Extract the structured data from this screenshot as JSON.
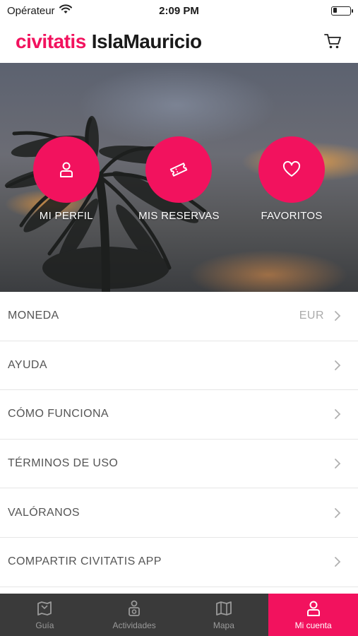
{
  "status_bar": {
    "carrier": "Opérateur",
    "time": "2:09 PM",
    "wifi_icon": "wifi-icon",
    "battery_icon": "battery-icon"
  },
  "header": {
    "brand": "civitatis",
    "city": "IslaMauricio",
    "cart_icon": "cart-icon",
    "brand_color": "#f2125e"
  },
  "hero": {
    "actions": [
      {
        "label": "MI PERFIL",
        "icon": "user-icon"
      },
      {
        "label": "MIS RESERVAS",
        "icon": "ticket-icon"
      },
      {
        "label": "FAVORITOS",
        "icon": "heart-icon"
      }
    ]
  },
  "menu": {
    "items": [
      {
        "label": "MONEDA",
        "value": "EUR"
      },
      {
        "label": "AYUDA"
      },
      {
        "label": "CÓMO FUNCIONA"
      },
      {
        "label": "TÉRMINOS DE USO"
      },
      {
        "label": "VALÓRANOS"
      },
      {
        "label": "COMPARTIR CIVITATIS APP"
      }
    ]
  },
  "tab_bar": {
    "tabs": [
      {
        "label": "Guía",
        "icon": "guide-icon",
        "active": false
      },
      {
        "label": "Actividades",
        "icon": "activities-icon",
        "active": false
      },
      {
        "label": "Mapa",
        "icon": "map-icon",
        "active": false
      },
      {
        "label": "Mi cuenta",
        "icon": "account-icon",
        "active": true
      }
    ],
    "active_color": "#f2125e"
  }
}
